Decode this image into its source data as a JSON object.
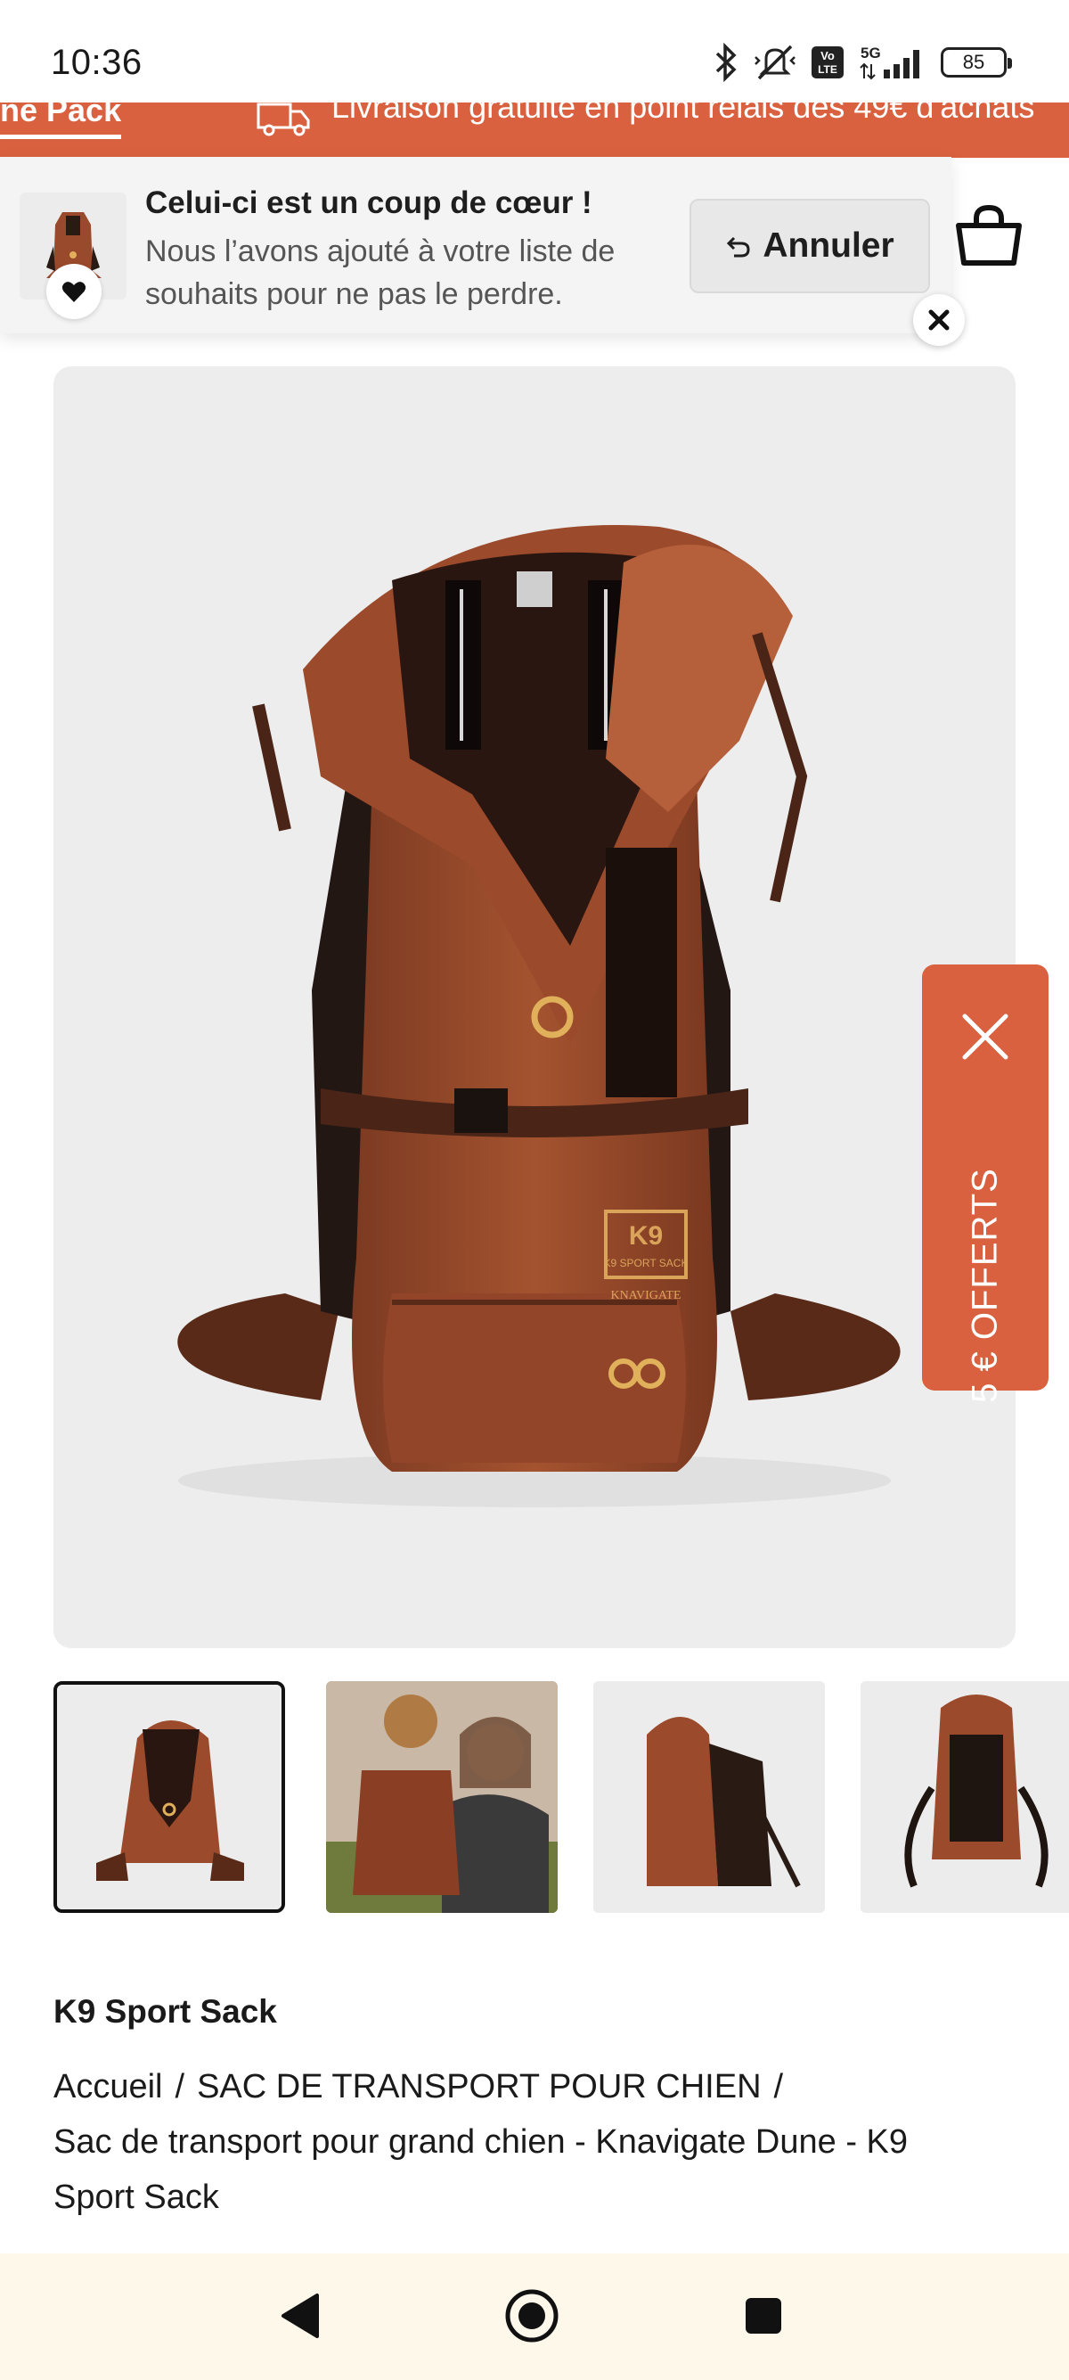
{
  "status_bar": {
    "time": "10:36",
    "battery": "85",
    "icons": [
      "bluetooth-icon",
      "mute-vibrate-icon",
      "volte-icon",
      "5g-signal-icon",
      "battery-icon"
    ]
  },
  "promo_banner": {
    "tab_label": "ne Pack",
    "text": "Livraison gratuite en point relais dès 49€ d'achats",
    "color": "#d9613f"
  },
  "toast": {
    "title": "Celui-ci est un coup de cœur !",
    "message": "Nous l’avons ajouté à votre liste de souhaits pour ne pas le perdre.",
    "undo_label": "Annuler"
  },
  "offer": {
    "label": "5 € OFFERTS",
    "color": "#d9613f"
  },
  "product": {
    "brand": "K9 Sport Sack",
    "image_label": "K9 SPORT SACK",
    "image_sub_label": "KNAVIGATE",
    "product_color": "#9a4a2c"
  },
  "breadcrumb": {
    "home": "Accueil",
    "category": "SAC DE TRANSPORT POUR CHIEN",
    "current": "Sac de transport pour grand chien - Knavigate Dune - K9 Sport Sack",
    "separator": "/"
  },
  "thumbnails": [
    {
      "label": "front view",
      "selected": true
    },
    {
      "label": "woman carrying dog",
      "selected": false
    },
    {
      "label": "side view",
      "selected": false
    },
    {
      "label": "back view",
      "selected": false
    }
  ],
  "nav": {
    "back": "back-icon",
    "home": "home-icon",
    "recents": "recents-icon"
  }
}
